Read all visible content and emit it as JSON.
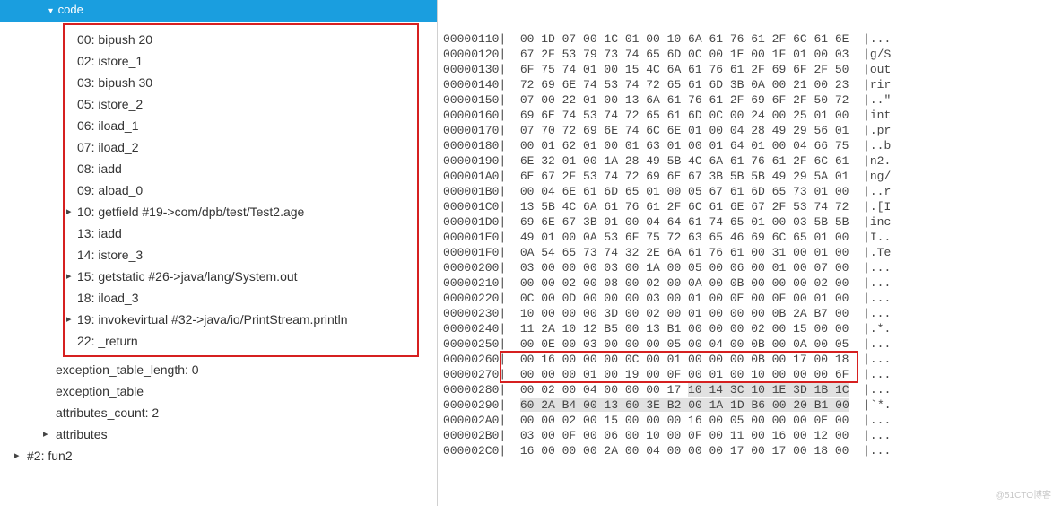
{
  "left": {
    "header": "code",
    "code_lines": [
      {
        "text": "00: bipush 20",
        "arrow": false
      },
      {
        "text": "02: istore_1",
        "arrow": false
      },
      {
        "text": "03: bipush 30",
        "arrow": false
      },
      {
        "text": "05: istore_2",
        "arrow": false
      },
      {
        "text": "06: iload_1",
        "arrow": false
      },
      {
        "text": "07: iload_2",
        "arrow": false
      },
      {
        "text": "08: iadd",
        "arrow": false
      },
      {
        "text": "09: aload_0",
        "arrow": false
      },
      {
        "text": "10: getfield #19->com/dpb/test/Test2.age",
        "arrow": true
      },
      {
        "text": "13: iadd",
        "arrow": false
      },
      {
        "text": "14: istore_3",
        "arrow": false
      },
      {
        "text": "15: getstatic #26->java/lang/System.out",
        "arrow": true
      },
      {
        "text": "18: iload_3",
        "arrow": false
      },
      {
        "text": "19: invokevirtual #32->java/io/PrintStream.println",
        "arrow": true
      },
      {
        "text": "22: _return",
        "arrow": false
      }
    ],
    "after_lines": [
      {
        "text": "exception_table_length: 0",
        "level": 1,
        "collapsible": false
      },
      {
        "text": "exception_table",
        "level": 1,
        "collapsible": false
      },
      {
        "text": "attributes_count: 2",
        "level": 1,
        "collapsible": false
      },
      {
        "text": "attributes",
        "level": 1,
        "collapsible": true
      },
      {
        "text": "#2: fun2",
        "level": 0,
        "collapsible": true
      }
    ]
  },
  "hex": {
    "rows": [
      {
        "addr": "00000110",
        "bytes": "00 1D 07 00 1C 01 00 10 6A 61 76 61 2F 6C 61 6E",
        "ascii": "|..."
      },
      {
        "addr": "00000120",
        "bytes": "67 2F 53 79 73 74 65 6D 0C 00 1E 00 1F 01 00 03",
        "ascii": "|g/S"
      },
      {
        "addr": "00000130",
        "bytes": "6F 75 74 01 00 15 4C 6A 61 76 61 2F 69 6F 2F 50",
        "ascii": "|out"
      },
      {
        "addr": "00000140",
        "bytes": "72 69 6E 74 53 74 72 65 61 6D 3B 0A 00 21 00 23",
        "ascii": "|rir"
      },
      {
        "addr": "00000150",
        "bytes": "07 00 22 01 00 13 6A 61 76 61 2F 69 6F 2F 50 72",
        "ascii": "|..\""
      },
      {
        "addr": "00000160",
        "bytes": "69 6E 74 53 74 72 65 61 6D 0C 00 24 00 25 01 00",
        "ascii": "|int"
      },
      {
        "addr": "00000170",
        "bytes": "07 70 72 69 6E 74 6C 6E 01 00 04 28 49 29 56 01",
        "ascii": "|.pr"
      },
      {
        "addr": "00000180",
        "bytes": "00 01 62 01 00 01 63 01 00 01 64 01 00 04 66 75",
        "ascii": "|..b"
      },
      {
        "addr": "00000190",
        "bytes": "6E 32 01 00 1A 28 49 5B 4C 6A 61 76 61 2F 6C 61",
        "ascii": "|n2."
      },
      {
        "addr": "000001A0",
        "bytes": "6E 67 2F 53 74 72 69 6E 67 3B 5B 5B 49 29 5A 01",
        "ascii": "|ng/"
      },
      {
        "addr": "000001B0",
        "bytes": "00 04 6E 61 6D 65 01 00 05 67 61 6D 65 73 01 00",
        "ascii": "|..r"
      },
      {
        "addr": "000001C0",
        "bytes": "13 5B 4C 6A 61 76 61 2F 6C 61 6E 67 2F 53 74 72",
        "ascii": "|.[I"
      },
      {
        "addr": "000001D0",
        "bytes": "69 6E 67 3B 01 00 04 64 61 74 65 01 00 03 5B 5B",
        "ascii": "|inc"
      },
      {
        "addr": "000001E0",
        "bytes": "49 01 00 0A 53 6F 75 72 63 65 46 69 6C 65 01 00",
        "ascii": "|I.."
      },
      {
        "addr": "000001F0",
        "bytes": "0A 54 65 73 74 32 2E 6A 61 76 61 00 31 00 01 00",
        "ascii": "|.Te"
      },
      {
        "addr": "00000200",
        "bytes": "03 00 00 00 03 00 1A 00 05 00 06 00 01 00 07 00",
        "ascii": "|..."
      },
      {
        "addr": "00000210",
        "bytes": "00 00 02 00 08 00 02 00 0A 00 0B 00 00 00 02 00",
        "ascii": "|..."
      },
      {
        "addr": "00000220",
        "bytes": "0C 00 0D 00 00 00 03 00 01 00 0E 00 0F 00 01 00",
        "ascii": "|..."
      },
      {
        "addr": "00000230",
        "bytes": "10 00 00 00 3D 00 02 00 01 00 00 00 0B 2A B7 00",
        "ascii": "|..."
      },
      {
        "addr": "00000240",
        "bytes": "11 2A 10 12 B5 00 13 B1 00 00 00 02 00 15 00 00",
        "ascii": "|.*."
      },
      {
        "addr": "00000250",
        "bytes": "00 0E 00 03 00 00 00 05 00 04 00 0B 00 0A 00 05",
        "ascii": "|..."
      },
      {
        "addr": "00000260",
        "bytes": "00 16 00 00 00 0C 00 01 00 00 00 0B 00 17 00 18",
        "ascii": "|..."
      },
      {
        "addr": "00000270",
        "bytes": "00 00 00 01 00 19 00 0F 00 01 00 10 00 00 00 6F",
        "ascii": "|..."
      },
      {
        "addr": "00000280",
        "bytes": "00 02 00 04 00 00 00 17 10 14 3C 10 1E 3D 1B 1C",
        "ascii": "|...",
        "hlStart": 8,
        "hlEnd": 16
      },
      {
        "addr": "00000290",
        "bytes": "60 2A B4 00 13 60 3E B2 00 1A 1D B6 00 20 B1 00",
        "ascii": "|`*.",
        "hlStart": 0,
        "hlEnd": 16
      },
      {
        "addr": "000002A0",
        "bytes": "00 00 02 00 15 00 00 00 16 00 05 00 00 00 0E 00",
        "ascii": "|..."
      },
      {
        "addr": "000002B0",
        "bytes": "03 00 0F 00 06 00 10 00 0F 00 11 00 16 00 12 00",
        "ascii": "|..."
      },
      {
        "addr": "000002C0",
        "bytes": "16 00 00 00 2A 00 04 00 00 00 17 00 17 00 18 00",
        "ascii": "|..."
      }
    ]
  }
}
